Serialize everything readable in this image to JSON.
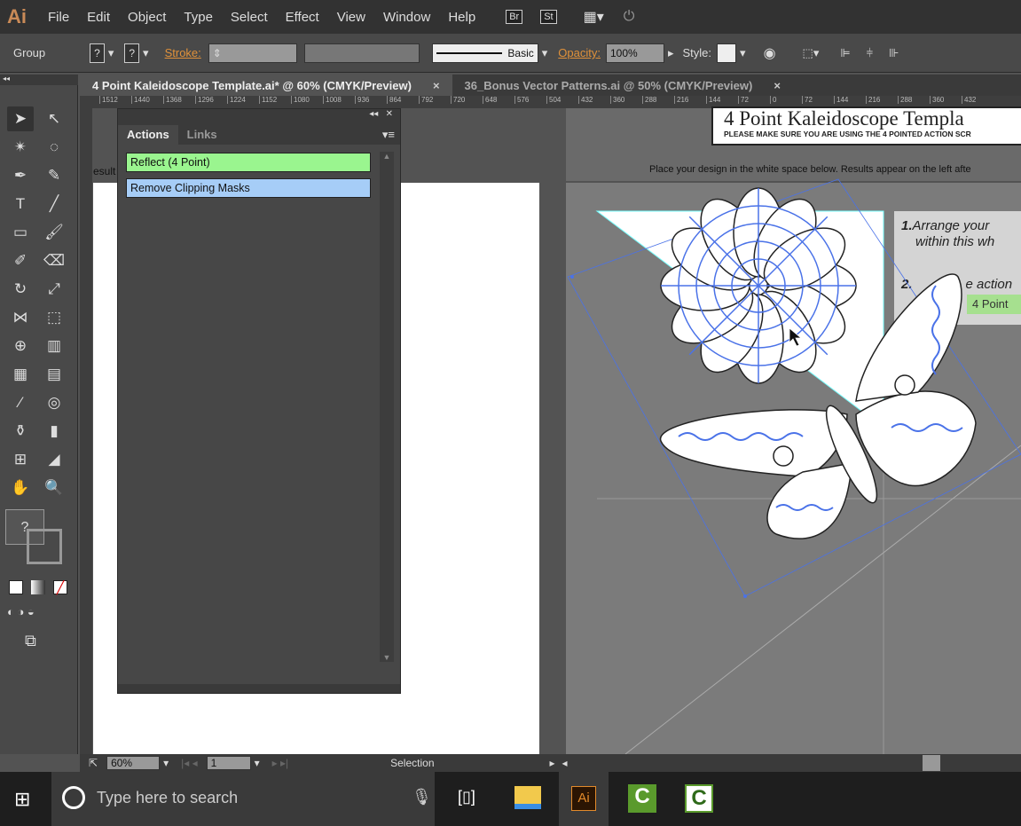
{
  "app": {
    "logo": "Ai",
    "menu": [
      "File",
      "Edit",
      "Object",
      "Type",
      "Select",
      "Effect",
      "View",
      "Window",
      "Help"
    ],
    "bridge": "Br",
    "stock": "St"
  },
  "control": {
    "selection_type": "Group",
    "fill": "?",
    "stroke_swatch": "?",
    "stroke_label": "Stroke:",
    "brush": "Basic",
    "opacity_label": "Opacity:",
    "opacity": "100%",
    "style_label": "Style:"
  },
  "tabs": [
    {
      "label": "4 Point Kaleidoscope Template.ai* @ 60% (CMYK/Preview)",
      "active": true
    },
    {
      "label": "36_Bonus Vector Patterns.ai @ 50% (CMYK/Preview)",
      "active": false
    }
  ],
  "ruler": [
    "1512",
    "1440",
    "1368",
    "1296",
    "1224",
    "1152",
    "1080",
    "1008",
    "936",
    "864",
    "792",
    "720",
    "648",
    "576",
    "504",
    "432",
    "360",
    "288",
    "216",
    "144",
    "72",
    "0",
    "72",
    "144",
    "216",
    "288",
    "360",
    "432"
  ],
  "panel": {
    "tabs": [
      "Actions",
      "Links"
    ],
    "actions": [
      {
        "label": "Reflect (4 Point)",
        "color": "#9af58f"
      },
      {
        "label": "Remove Clipping Masks",
        "color": "#a6cdf7"
      }
    ]
  },
  "canvas": {
    "left_text": "esult",
    "title": "4 Point Kaleidoscope Templa",
    "subtitle": "PLEASE MAKE SURE YOU ARE USING THE 4 POINTED ACTION SCR",
    "instruction": "Place your design in the white space below. Results appear on the left afte",
    "step1_num": "1.",
    "step1": "Arrange your",
    "step1b": "within this wh",
    "step2_num": "2.",
    "step2": "e action",
    "step2_btn": "4 Point",
    "selection_color": "#4a72e8"
  },
  "status": {
    "zoom": "60%",
    "artboard": "1",
    "tool": "Selection"
  },
  "taskbar": {
    "search_placeholder": "Type here to search",
    "apps": [
      "file-explorer",
      "illustrator",
      "camtasia-recorder",
      "camtasia"
    ],
    "ai_label": "Ai"
  }
}
